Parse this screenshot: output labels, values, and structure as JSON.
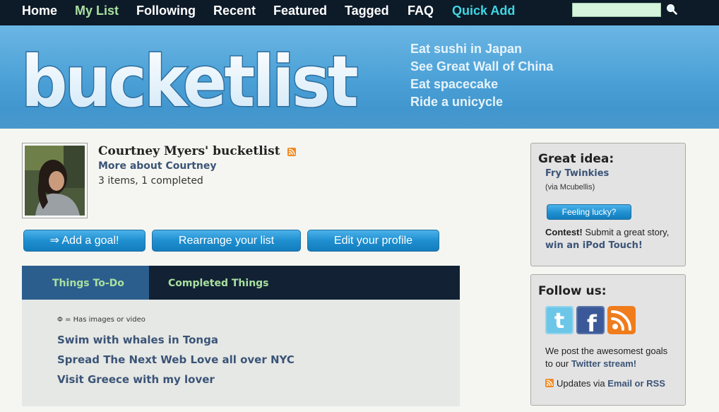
{
  "nav": {
    "items": [
      {
        "label": "Home"
      },
      {
        "label": "My List"
      },
      {
        "label": "Following"
      },
      {
        "label": "Recent"
      },
      {
        "label": "Featured"
      },
      {
        "label": "Tagged"
      },
      {
        "label": "FAQ"
      },
      {
        "label": "Quick Add"
      }
    ],
    "search_value": ""
  },
  "banner": {
    "logo_text": "bucketlist",
    "taglines": [
      "Eat sushi in Japan",
      "See Great Wall of China",
      "Eat spacecake",
      "Ride a unicycle"
    ]
  },
  "profile": {
    "title": "Courtney Myers' bucketlist",
    "more_link": "More about Courtney",
    "stats": "3 items, 1 completed"
  },
  "actions": {
    "add_goal": "⇒ Add a goal!",
    "rearrange": "Rearrange your list",
    "edit_profile": "Edit your profile"
  },
  "tabs": {
    "todo": "Things To-Do",
    "completed": "Completed Things"
  },
  "list": {
    "legend": "Φ = Has images or video",
    "items": [
      "Swim with whales in Tonga",
      "Spread The Next Web Love all over NYC",
      "Visit Greece with my lover"
    ]
  },
  "idea": {
    "heading": "Great idea:",
    "link": "Fry Twinkies",
    "via": "(via Mcubellis)",
    "lucky_button": "Feeling lucky?",
    "contest_label": "Contest!",
    "contest_text": " Submit a great story,",
    "contest_link": "win an iPod Touch!"
  },
  "follow": {
    "heading": "Follow us:",
    "line1": "We post the awesomest goals",
    "line2_prefix": "to our ",
    "line2_link": "Twitter stream!",
    "updates_prefix": "Updates via ",
    "updates_link": "Email or RSS"
  },
  "colors": {
    "nav_bg": "#0d1a28",
    "nav_active": "#a9e0a0",
    "nav_quick": "#3fd6e2",
    "banner": "#4aa0d6",
    "link": "#3b5477",
    "button": "#1f8fd0",
    "tab_active": "#2c5e8d",
    "tab_bar": "#122234"
  },
  "icons": [
    "search-icon",
    "rss-icon",
    "twitter-icon",
    "facebook-icon"
  ]
}
